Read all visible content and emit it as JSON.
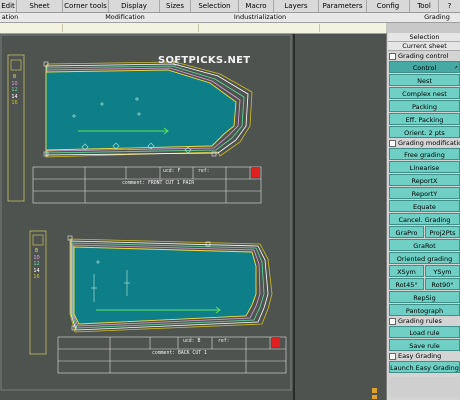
{
  "menubar": {
    "items": [
      "Edit",
      "Sheet",
      "Corner tools",
      "Display",
      "Sizes",
      "Selection",
      "Macro",
      "Layers",
      "Parameters",
      "Config",
      "Tool"
    ]
  },
  "tabs": {
    "items": [
      "ation",
      "Modification",
      "Industrialization",
      "Grading"
    ]
  },
  "watermark": "SOFTPICKS.NET",
  "pieces": {
    "front": {
      "sizes": [
        "8",
        "10",
        "12",
        "14",
        "16"
      ],
      "comment": "comment: FRONT CUT 1 PAIR",
      "code_label": "ucd: F",
      "ref_label": "ref:"
    },
    "back": {
      "sizes": [
        "8",
        "10",
        "12",
        "14",
        "16"
      ],
      "comment": "comment: BACK CUT 1",
      "code_label": "ucd: B",
      "ref_label": "ref:"
    }
  },
  "colors": {
    "canvas": "#4f5350",
    "piece_fill": "#0e7f88",
    "size_lines": [
      "#f0e040",
      "#e0a0e0",
      "#60e0a0",
      "#ffffff",
      "#d0c020"
    ],
    "button": "#6fcfc4",
    "marker": "#e02020"
  },
  "panel": {
    "top_label": "Selection",
    "sheet_label": "Current sheet",
    "sections": [
      "Grading control",
      "Grading modification",
      "Grading rules",
      "Easy Grading"
    ],
    "buttons": {
      "control": "Control",
      "nest": "Nest",
      "complex_nest": "Complex nest",
      "packing": "Packing",
      "eff_packing": "Eff. Packing",
      "orient": "Orient. 2 pts",
      "free_grading": "Free grading",
      "linearise": "Linearise",
      "reportx": "ReportX",
      "reporty": "ReportY",
      "equate": "Equate",
      "cancel_grading": "Cancel. Grading",
      "grapro": "GraPro",
      "proj2pts": "Proj2Pts",
      "grarot": "GraRot",
      "oriented_grading": "Oriented grading",
      "xsym": "XSym",
      "ysym": "YSym",
      "rot45": "Rot45°",
      "rot90": "Rot90°",
      "repsig": "RepSig",
      "pantograph": "Pantograph",
      "load_rule": "Load rule",
      "save_rule": "Save rule",
      "launch_easy": "Launch Easy Grading"
    }
  }
}
